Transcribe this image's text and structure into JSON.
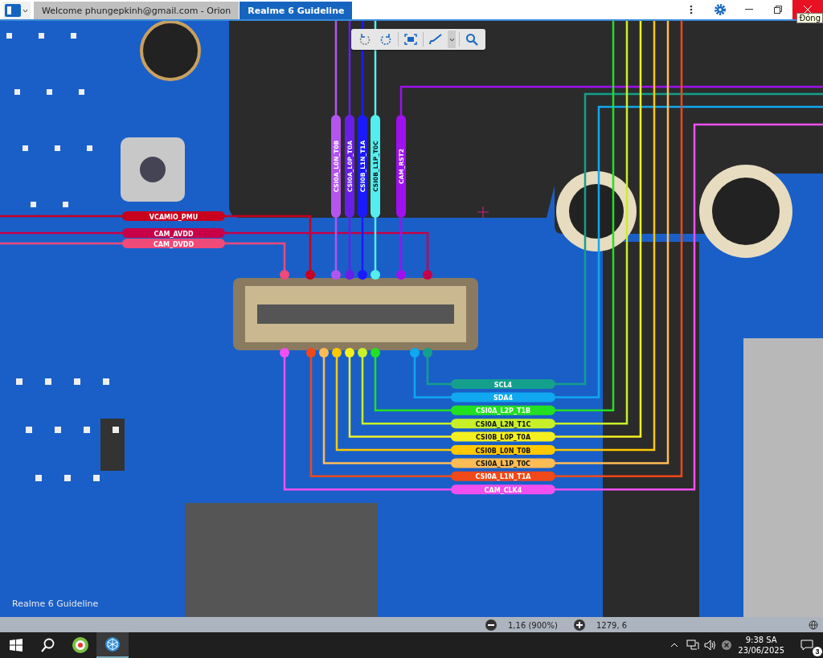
{
  "tabs": [
    {
      "label": "Welcome phungepkinh@gmail.com - Orion",
      "selected": false
    },
    {
      "label": "Realme 6 Guideline",
      "selected": true
    }
  ],
  "tooltip": "Đóng",
  "nets": [
    {
      "kind": "left",
      "name": "VCAMIO_PMU",
      "color": "#c8001e"
    },
    {
      "kind": "left",
      "name": "CAM_AVDD",
      "color": "#c80048"
    },
    {
      "kind": "left",
      "name": "CAM_DVDD",
      "color": "#f04a78"
    },
    {
      "kind": "top",
      "name": "CSI0A_L0N_T0B",
      "color": "#b455ee"
    },
    {
      "kind": "top",
      "name": "CSI0A_L0P_T0A",
      "color": "#6a1fe8"
    },
    {
      "kind": "top",
      "name": "CSI0B_L1N_T1A",
      "color": "#1a1aff"
    },
    {
      "kind": "top",
      "name": "CSI0B_L1P_T0C",
      "color": "#55eef0"
    },
    {
      "kind": "top",
      "name": "CAM_RST2",
      "color": "#a010f0"
    },
    {
      "kind": "bottom",
      "name": "SCL4",
      "color": "#14a08c"
    },
    {
      "kind": "bottom",
      "name": "SDA4",
      "color": "#10a8f0"
    },
    {
      "kind": "bottom",
      "name": "CSI0A_L2P_T1B",
      "color": "#22e022"
    },
    {
      "kind": "bottom",
      "name": "CSI0A_L2N_T1C",
      "color": "#c8f028"
    },
    {
      "kind": "bottom",
      "name": "CSI0B_L0P_T0A",
      "color": "#f4f020"
    },
    {
      "kind": "bottom",
      "name": "CSI0B_L0N_T0B",
      "color": "#ffc800"
    },
    {
      "kind": "bottom",
      "name": "CSI0A_L1P_T0C",
      "color": "#ffbc55"
    },
    {
      "kind": "bottom",
      "name": "CSI0A_L1N_T1A",
      "color": "#f04818"
    },
    {
      "kind": "bottom",
      "name": "CAM_CLK4",
      "color": "#f050f0"
    }
  ],
  "caption": "Realme 6 Guideline",
  "status_bar": {
    "zoom": "1,16 (900%)",
    "coordinates": "1279, 6"
  },
  "taskbar": {
    "time": "9:38 SA",
    "date": "23/06/2025",
    "notifications": "3"
  }
}
